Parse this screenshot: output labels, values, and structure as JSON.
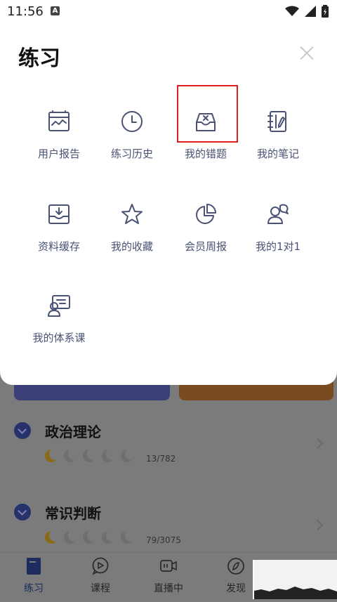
{
  "status_bar": {
    "time": "11:56",
    "badge": "A"
  },
  "sheet": {
    "title": "练习",
    "items": [
      {
        "label": "用户报告",
        "icon": "report-chart-icon"
      },
      {
        "label": "练习历史",
        "icon": "clock-icon"
      },
      {
        "label": "我的错题",
        "icon": "wrong-tray-icon"
      },
      {
        "label": "我的笔记",
        "icon": "notebook-icon"
      },
      {
        "label": "资料缓存",
        "icon": "download-tray-icon"
      },
      {
        "label": "我的收藏",
        "icon": "star-icon"
      },
      {
        "label": "会员周报",
        "icon": "pie-chart-icon"
      },
      {
        "label": "我的1对1",
        "icon": "chat-person-icon"
      },
      {
        "label": "我的体系课",
        "icon": "teacher-board-icon"
      }
    ]
  },
  "background": {
    "sections": [
      {
        "title": "政治理论",
        "stars_filled": 1,
        "stars_total": 5,
        "count": "13/782"
      },
      {
        "title": "常识判断",
        "stars_filled": 1,
        "stars_total": 5,
        "count": "79/3075"
      }
    ]
  },
  "tabbar": {
    "tabs": [
      {
        "label": "练习",
        "icon": "book-icon",
        "active": true
      },
      {
        "label": "课程",
        "icon": "play-bubble-icon",
        "active": false
      },
      {
        "label": "直播中",
        "icon": "live-camera-icon",
        "active": false
      },
      {
        "label": "发现",
        "icon": "compass-icon",
        "active": false
      }
    ]
  },
  "colors": {
    "icon_stroke": "#4a5275",
    "highlight": "#e02020",
    "dim_overlay": "#7b7b7b"
  }
}
